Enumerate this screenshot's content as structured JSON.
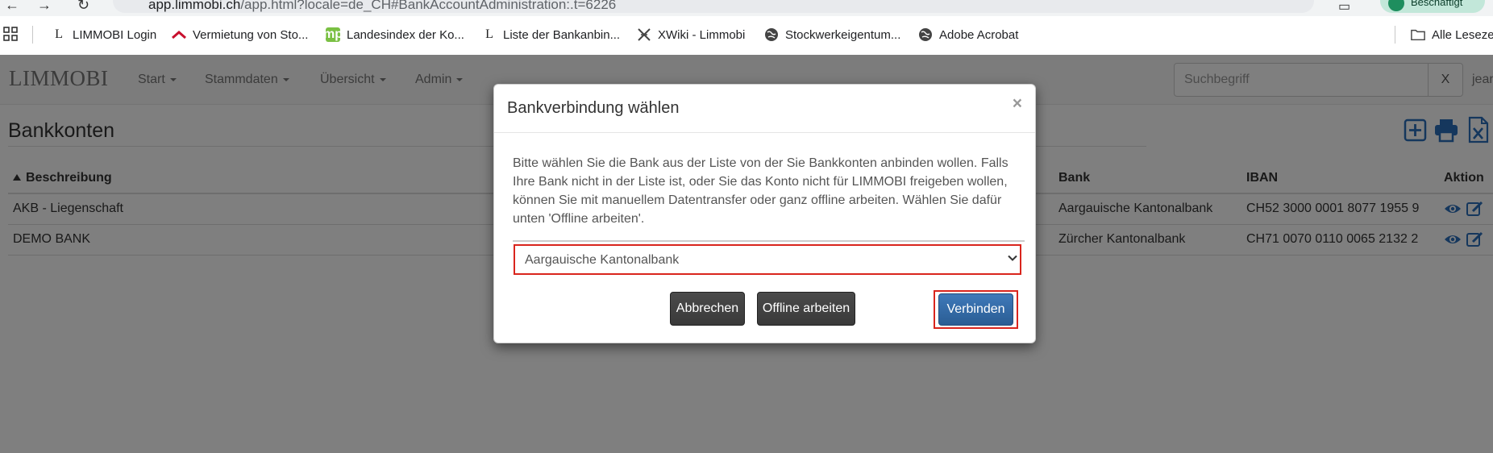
{
  "browser": {
    "url_host": "app.limmobi.ch",
    "url_rest": "/app.html?locale=de_CH#BankAccountAdministration:.t=6226",
    "profile_label": "Beschäftigt",
    "bookmarks": [
      {
        "label": "LIMMOBI Login",
        "icon": "limmobi-l-icon"
      },
      {
        "label": "Vermietung von Sto...",
        "icon": "chevron-logo-icon"
      },
      {
        "label": "Landesindex der Ko...",
        "icon": "mp-logo-icon"
      },
      {
        "label": "Liste der Bankanbin...",
        "icon": "limmobi-l-icon"
      },
      {
        "label": "XWiki - Limmobi",
        "icon": "xwiki-icon"
      },
      {
        "label": "Stockwerkeigentum...",
        "icon": "globe-icon"
      },
      {
        "label": "Adobe Acrobat",
        "icon": "globe-icon"
      }
    ],
    "all_bookmarks_label": "Alle Lesezeichen"
  },
  "navbar": {
    "brand": "LIMMOBI",
    "menus": [
      "Start",
      "Stammdaten",
      "Übersicht",
      "Admin"
    ],
    "search_placeholder": "Suchbegriff",
    "search_clear": "X",
    "user": "jean"
  },
  "page": {
    "title": "Bankkonten",
    "tools": [
      "add-icon",
      "print-icon",
      "excel-export-icon"
    ]
  },
  "table": {
    "headers": {
      "beschreibung": "Beschreibung",
      "bank": "Bank",
      "iban": "IBAN",
      "aktion": "Aktion"
    },
    "rows": [
      {
        "beschreibung": "AKB - Liegenschaft",
        "bank": "Aargauische Kantonalbank",
        "iban": "CH52 3000 0001 8077 1955 9"
      },
      {
        "beschreibung": "DEMO BANK",
        "bank": "Zürcher Kantonalbank",
        "iban": "CH71 0070 0110 0065 2132 2"
      }
    ]
  },
  "modal": {
    "title": "Bankverbindung wählen",
    "close": "×",
    "text": "Bitte wählen Sie die Bank aus der Liste von der Sie Bankkonten anbinden wollen. Falls Ihre Bank nicht in der Liste ist, oder Sie das Konto nicht für LIMMOBI freigeben wollen, können Sie mit manuellem Datentransfer oder ganz offline arbeiten. Wählen Sie dafür unten 'Offline arbeiten'.",
    "selected_bank": "Aargauische Kantonalbank",
    "buttons": {
      "cancel": "Abbrechen",
      "offline": "Offline arbeiten",
      "connect": "Verbinden"
    }
  },
  "colors": {
    "highlight": "#d9251d",
    "primary": "#337ab7",
    "icon_blue": "#2a6ebb"
  }
}
